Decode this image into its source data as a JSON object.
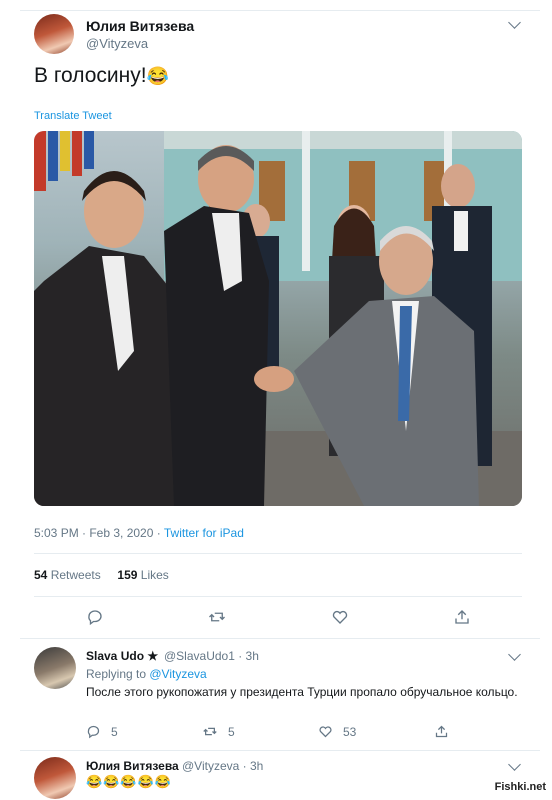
{
  "tweet": {
    "author_name": "Юлия Витязева",
    "author_handle": "@Vityzeva",
    "text": "В голосину!",
    "emoji": "😂",
    "translate_label": "Translate Tweet",
    "timestamp": "5:03 PM · Feb 3, 2020 · ",
    "source": "Twitter for iPad",
    "retweets_count": "54",
    "retweets_label": "Retweets",
    "likes_count": "159",
    "likes_label": "Likes",
    "icons": [
      "reply-icon",
      "retweet-icon",
      "like-icon",
      "share-icon"
    ]
  },
  "reply1": {
    "author_name": "Slava Udo ★",
    "author_handle": "@SlavaUdo1 · 3h",
    "replying_label": "Replying to ",
    "replying_handle": "@Vityzeva",
    "text": "После этого рукопожатия у президента Турции пропало обручальное кольцо.",
    "replies": "5",
    "retweets": "5",
    "likes": "53"
  },
  "reply2": {
    "author_name": "Юлия Витязева",
    "author_handle": "@Vityzeva · 3h",
    "text": "😂😂😂😂😂"
  },
  "watermark": "Fishki.net",
  "colors": {
    "accent": "#1b95e0",
    "muted": "#657786",
    "text": "#14171a"
  }
}
